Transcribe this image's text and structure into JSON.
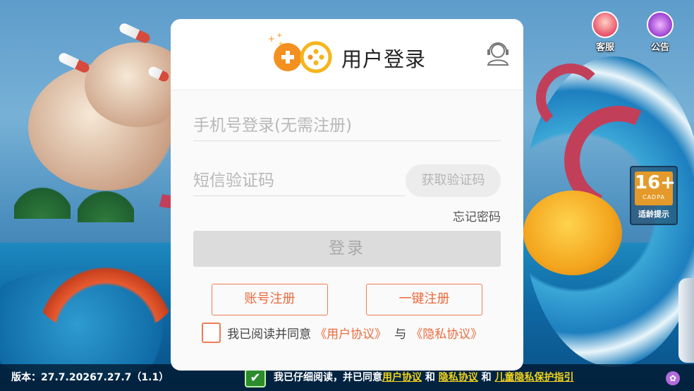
{
  "dialog": {
    "title": "用户登录",
    "phone_placeholder": "手机号登录(无需注册)",
    "sms_placeholder": "短信验证码",
    "get_code_label": "获取验证码",
    "forgot_label": "忘记密码",
    "login_label": "登录",
    "account_register_label": "账号注册",
    "onekey_register_label": "一键注册",
    "agree_text": "我已阅读并同意",
    "user_agreement": "《用户协议》",
    "and_text": "与",
    "privacy_agreement": "《隐私协议》"
  },
  "top_icons": {
    "customer_service": "客服",
    "notice": "公告"
  },
  "age_badge": {
    "rating": "16+",
    "org": "CADPA",
    "tip": "适龄提示"
  },
  "bottom_bar": {
    "version": "版本：27.7.20267.27.7（1.1）",
    "consent_prefix": "我已仔细阅读，并已同意",
    "user_agreement": "用户协议",
    "and1": "和",
    "privacy_agreement": "隐私协议",
    "and2": "和",
    "child_privacy": "儿童隐私保护指引"
  },
  "colors": {
    "accent_orange": "#ec6a3c",
    "logo_orange": "#f3901f",
    "logo_yellow": "#f5b51c",
    "disabled_gray": "#dcdcdc",
    "link_yellow": "#f1d31c",
    "checkbox_green": "#2c8b2c"
  },
  "icons": {
    "logo": "gamepad-logo-icon",
    "support": "headset-support-icon",
    "customer_service": "customer-service-icon",
    "notice": "megaphone-icon",
    "checked": "checkmark-icon",
    "bottom_right": "flower-icon"
  }
}
